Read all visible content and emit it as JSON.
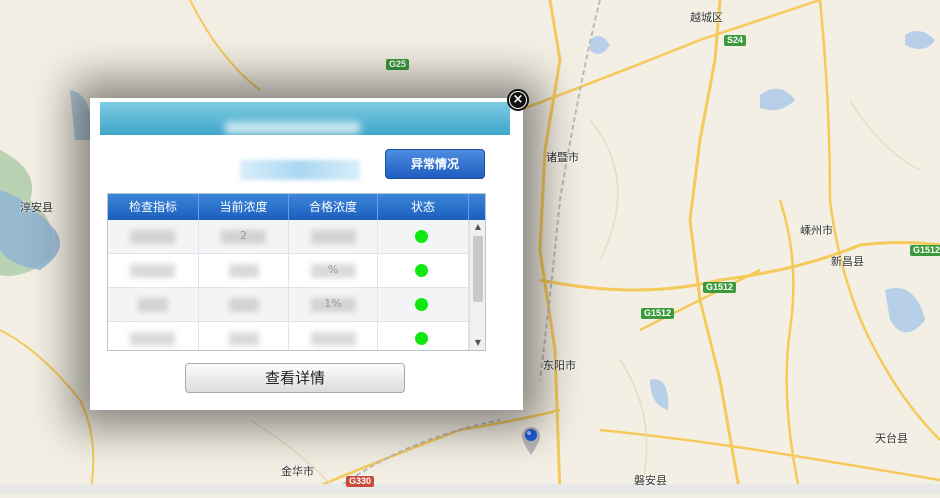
{
  "map": {
    "city_labels": {
      "yuecheng": "越城区",
      "zhuji": "诸暨市",
      "chunan": "淳安县",
      "shengzhou": "嵊州市",
      "xinchang": "新昌县",
      "dongyang": "东阳市",
      "tiantai": "天台县",
      "jinhua": "金华市",
      "panan": "磐安县"
    },
    "road_shields": {
      "s24": "S24",
      "g25": "G25",
      "g1512_a": "G1512",
      "g1512_b": "G1512",
      "g1512_c": "G1512",
      "g330": "G330"
    },
    "colors": {
      "land": "#f3efe4",
      "water": "#b7cfe8",
      "road": "#f6c95b",
      "green": "#9fc69f"
    }
  },
  "popup": {
    "anomaly_button": "异常情况",
    "detail_button": "查看详情",
    "close_icon": "close-icon",
    "table": {
      "headers": [
        "检查指标",
        "当前浓度",
        "合格浓度",
        "状态"
      ],
      "rows": [
        {
          "c1": "",
          "c2": "2",
          "c3": "",
          "status_color": "#11e811"
        },
        {
          "c1": "",
          "c2": "",
          "c3": "%",
          "status_color": "#11e811"
        },
        {
          "c1": "",
          "c2": "",
          "c3": "1%",
          "status_color": "#11e811"
        },
        {
          "c1": "",
          "c2": "",
          "c3": "",
          "status_color": "#11e811"
        }
      ]
    }
  }
}
